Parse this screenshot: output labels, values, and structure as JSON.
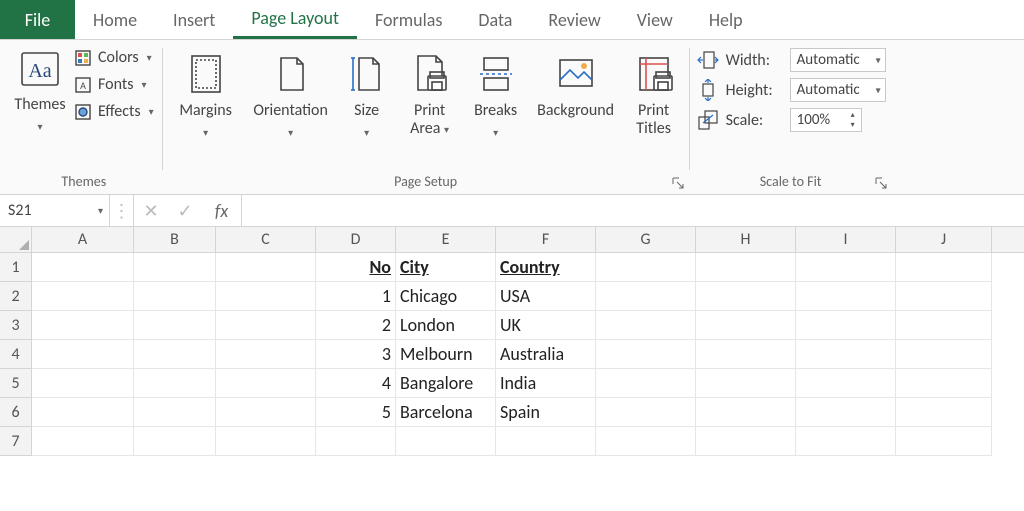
{
  "tabs": {
    "file": "File",
    "items": [
      "Home",
      "Insert",
      "Page Layout",
      "Formulas",
      "Data",
      "Review",
      "View",
      "Help"
    ],
    "active_index": 2
  },
  "ribbon": {
    "themes": {
      "group_label": "Themes",
      "themes_label": "Themes",
      "colors_label": "Colors",
      "fonts_label": "Fonts",
      "effects_label": "Effects"
    },
    "page_setup": {
      "group_label": "Page Setup",
      "margins": "Margins",
      "orientation": "Orientation",
      "size": "Size",
      "print_area_l1": "Print",
      "print_area_l2": "Area",
      "breaks": "Breaks",
      "background": "Background",
      "print_titles_l1": "Print",
      "print_titles_l2": "Titles"
    },
    "scale_to_fit": {
      "group_label": "Scale to Fit",
      "width_label": "Width:",
      "height_label": "Height:",
      "scale_label": "Scale:",
      "width_value": "Automatic",
      "height_value": "Automatic",
      "scale_value": "100%"
    }
  },
  "formula_bar": {
    "name_box": "S21",
    "fx": "fx",
    "content": ""
  },
  "sheet": {
    "columns": [
      "A",
      "B",
      "C",
      "D",
      "E",
      "F",
      "G",
      "H",
      "I",
      "J"
    ],
    "row_count": 7,
    "headers": {
      "D": "No",
      "E": "City",
      "F": "Country"
    },
    "rows": [
      {
        "D": "1",
        "E": "Chicago",
        "F": "USA"
      },
      {
        "D": "2",
        "E": "London",
        "F": "UK"
      },
      {
        "D": "3",
        "E": "Melbourn",
        "F": "Australia"
      },
      {
        "D": "4",
        "E": "Bangalore",
        "F": "India"
      },
      {
        "D": "5",
        "E": "Barcelona",
        "F": "Spain"
      }
    ]
  }
}
